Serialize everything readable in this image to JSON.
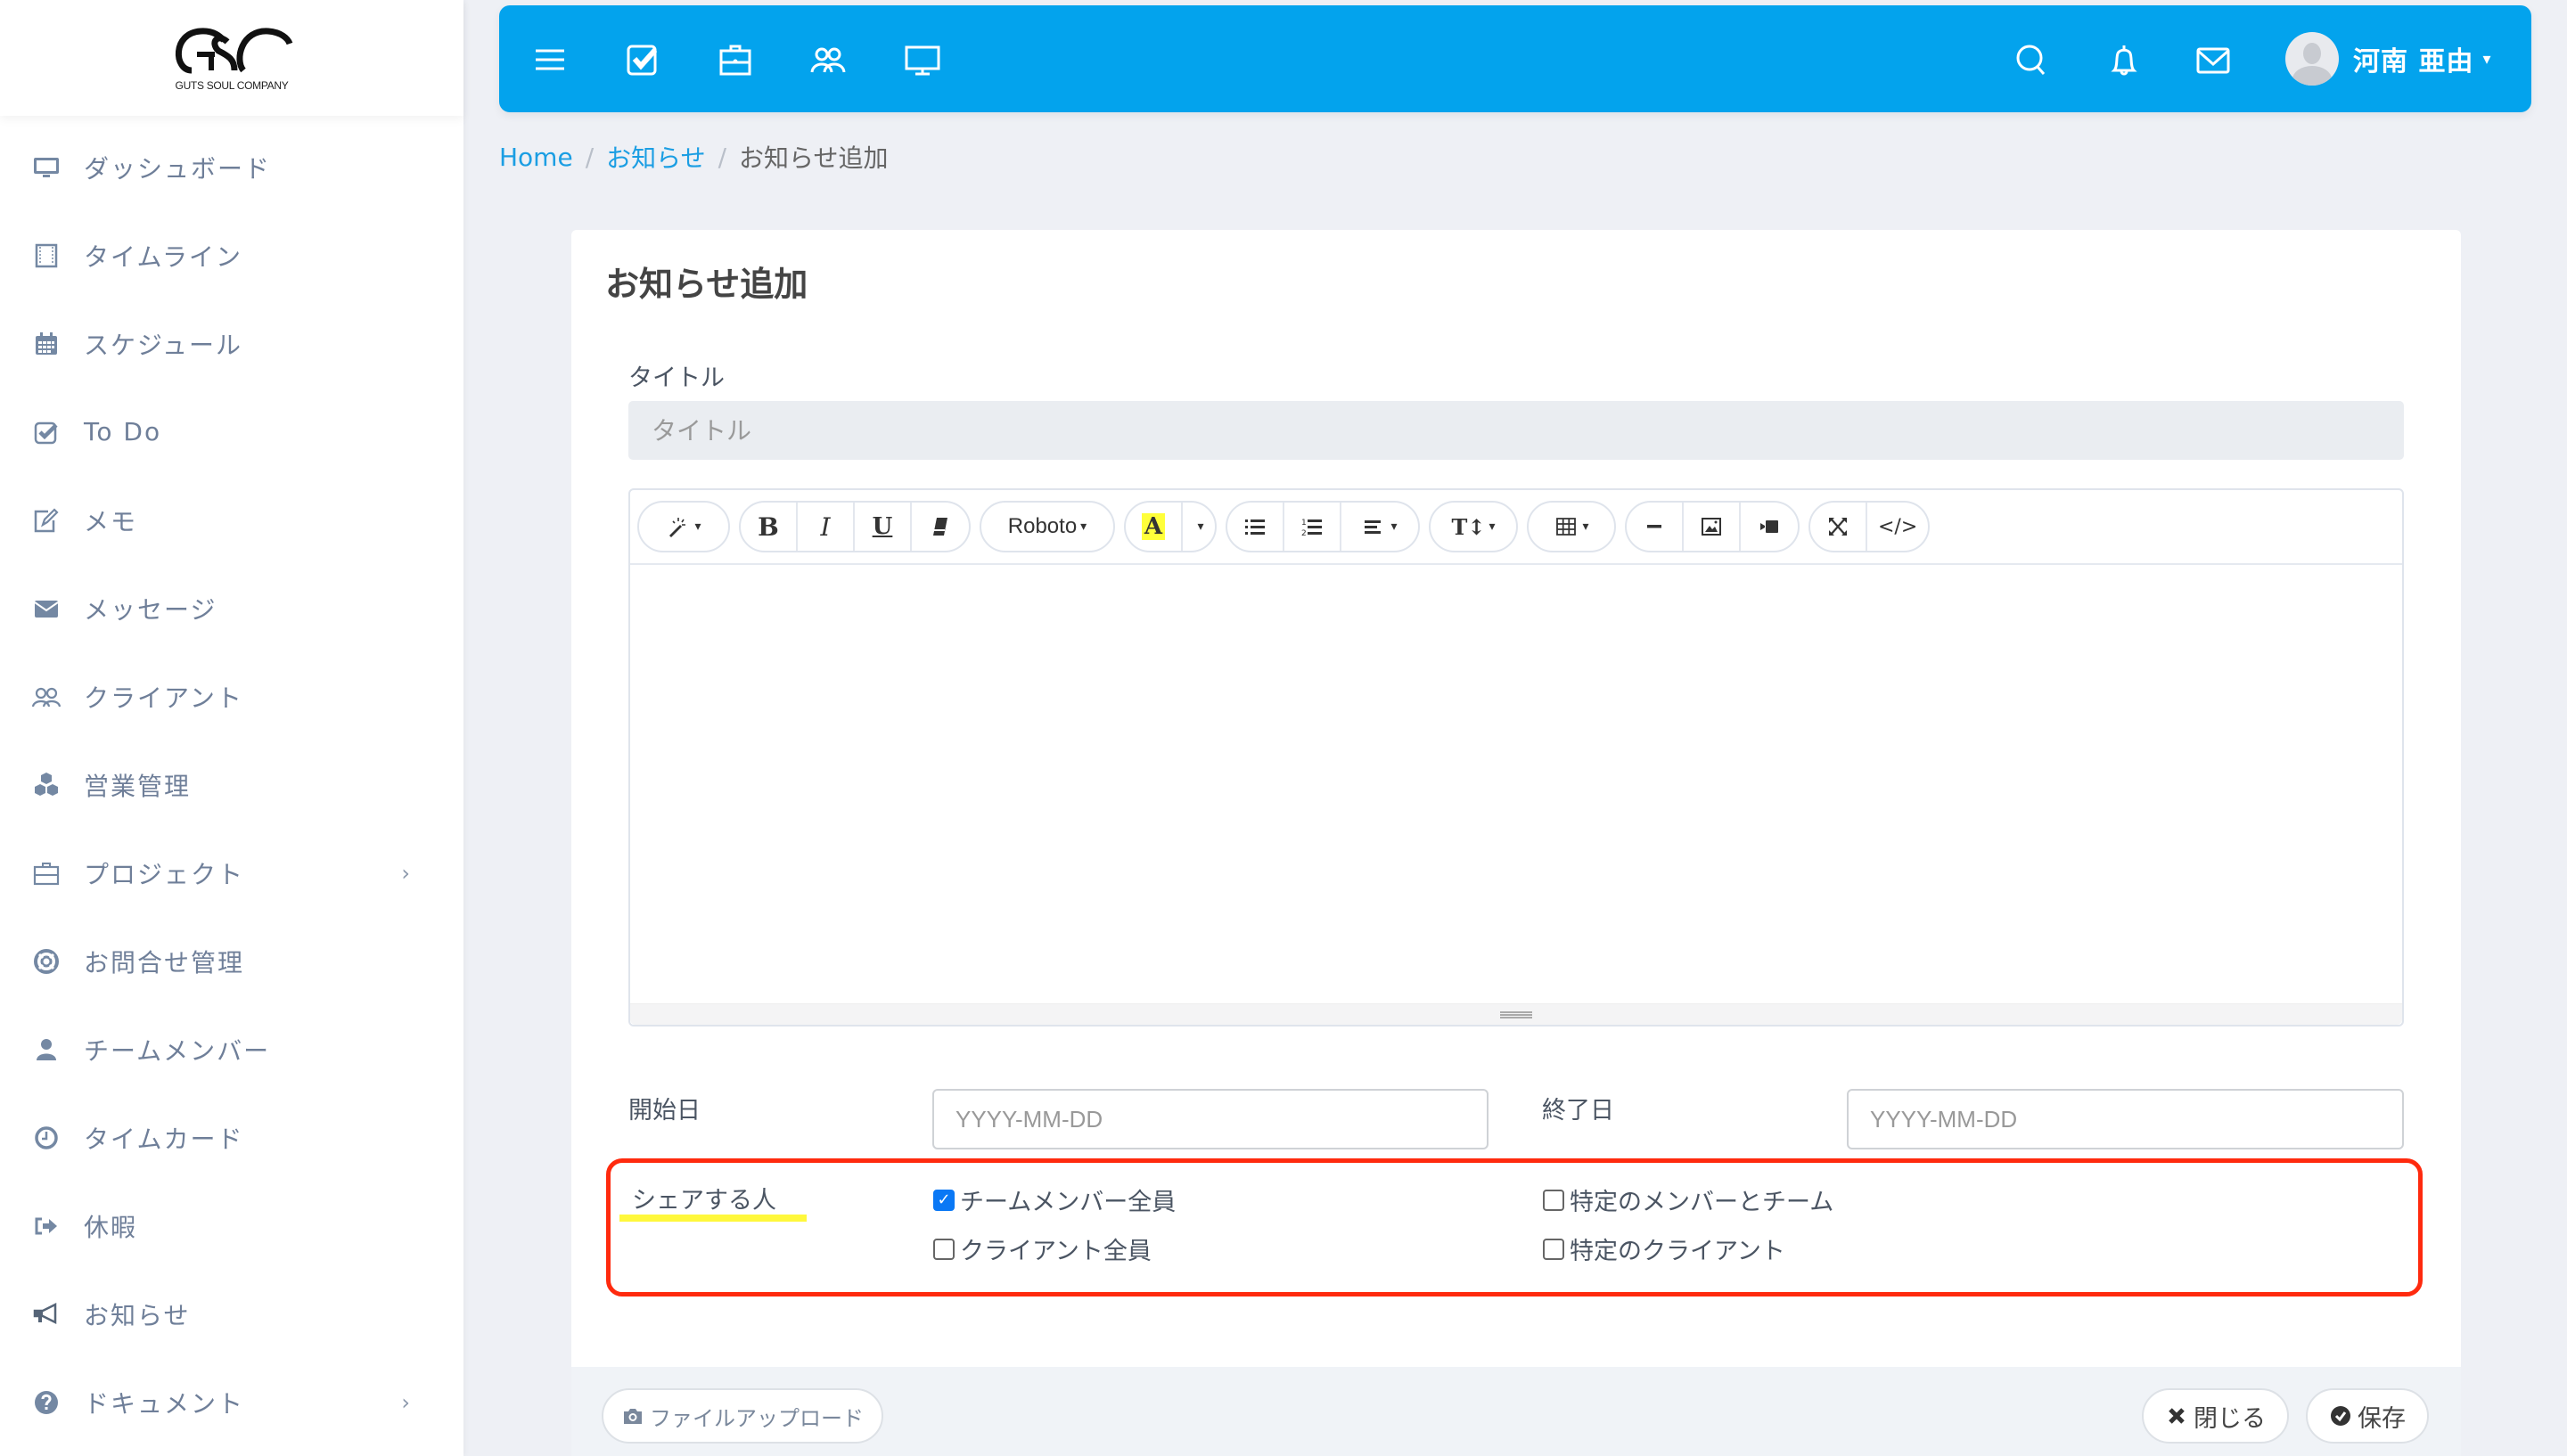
{
  "logo": {
    "text": "GUTS SOUL COMPANY",
    "mark": "GSC"
  },
  "sidebar": {
    "items": [
      {
        "label": "ダッシュボード",
        "icon": "monitor-icon"
      },
      {
        "label": "タイムライン",
        "icon": "film-icon"
      },
      {
        "label": "スケジュール",
        "icon": "calendar-icon"
      },
      {
        "label": "To Do",
        "icon": "checkbox-icon"
      },
      {
        "label": "メモ",
        "icon": "edit-icon"
      },
      {
        "label": "メッセージ",
        "icon": "envelope-icon"
      },
      {
        "label": "クライアント",
        "icon": "users-icon"
      },
      {
        "label": "営業管理",
        "icon": "cubes-icon"
      },
      {
        "label": "プロジェクト",
        "icon": "briefcase-icon",
        "chevron": "›"
      },
      {
        "label": "お問合せ管理",
        "icon": "lifebuoy-icon"
      },
      {
        "label": "チームメンバー",
        "icon": "user-icon"
      },
      {
        "label": "タイムカード",
        "icon": "clock-icon"
      },
      {
        "label": "休暇",
        "icon": "sign-out-icon"
      },
      {
        "label": "お知らせ",
        "icon": "bullhorn-icon"
      },
      {
        "label": "ドキュメント",
        "icon": "question-icon",
        "chevron": "›"
      }
    ]
  },
  "topbar": {
    "color": "#03a3ed",
    "left_icons": [
      "menu-icon",
      "checkbox-icon",
      "briefcase-icon",
      "users-icon",
      "monitor-icon"
    ],
    "right_icons": [
      "search-icon",
      "bell-icon",
      "envelope-icon"
    ],
    "user_name": "河南 亜由",
    "user_caret": "▾"
  },
  "breadcrumb": {
    "home": "Home",
    "parent": "お知らせ",
    "current": "お知らせ追加",
    "separator": "/"
  },
  "form": {
    "title": "お知らせ追加",
    "title_label": "タイトル",
    "title_placeholder": "タイトル",
    "title_value": "",
    "editor": {
      "font_name": "Roboto",
      "toolbar_groups": [
        [
          "style"
        ],
        [
          "bold",
          "italic",
          "underline",
          "clear-format"
        ],
        [
          "font-name"
        ],
        [
          "highlight-color",
          "color-dropdown"
        ],
        [
          "unordered-list",
          "ordered-list",
          "paragraph-align"
        ],
        [
          "font-size"
        ],
        [
          "table"
        ],
        [
          "horizontal-rule",
          "picture",
          "video"
        ],
        [
          "fullscreen",
          "code-view"
        ]
      ],
      "bold_glyph": "B",
      "italic_glyph": "I",
      "underline_glyph": "U",
      "highlight_glyph": "A",
      "fontsize_glyph": "T↕",
      "code_glyph": "</>",
      "caret": "▾",
      "content": ""
    },
    "start_date_label": "開始日",
    "start_date_placeholder": "YYYY-MM-DD",
    "end_date_label": "終了日",
    "end_date_placeholder": "YYYY-MM-DD",
    "share": {
      "label": "シェアする人",
      "highlight_color": "#fff83c",
      "box_color": "#ff2a0e",
      "options": [
        {
          "label": "チームメンバー全員",
          "checked": true
        },
        {
          "label": "特定のメンバーとチーム",
          "checked": false
        },
        {
          "label": "クライアント全員",
          "checked": false
        },
        {
          "label": "特定のクライアント",
          "checked": false
        }
      ]
    },
    "footer": {
      "upload_label": "ファイルアップロード",
      "close_label": "閉じる",
      "save_label": "保存"
    }
  }
}
